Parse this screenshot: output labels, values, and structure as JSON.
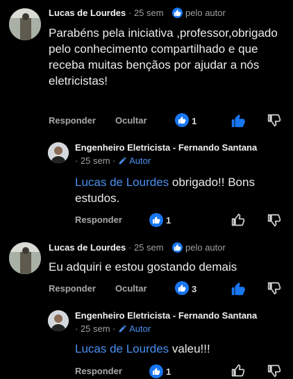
{
  "comments": [
    {
      "author": "Lucas de Lourdes",
      "time": "· 25 sem",
      "author_badge": "pelo autor",
      "text": "Parabéns pela iniciativa ,professor,obrigado pelo conhecimento compartilhado e que receba muitas bençãos por ajudar a nós eletricistas!",
      "reply_label": "Responder",
      "hide_label": "Ocultar",
      "like_count": "1",
      "liked": true,
      "reply": {
        "author": "Engenheiro Eletricista -  Fernando Santana",
        "time": "· 25 sem ·",
        "author_tag": "Autor",
        "mention": "Lucas de Lourdes",
        "text": " obrigado!! Bons estudos.",
        "reply_label": "Responder",
        "like_count": "1"
      }
    },
    {
      "author": "Lucas de Lourdes",
      "time": "· 25 sem",
      "author_badge": "pelo autor",
      "text": "Eu adquiri e  estou gostando demais",
      "reply_label": "Responder",
      "hide_label": "Ocultar",
      "like_count": "3",
      "liked": true,
      "reply": {
        "author": "Engenheiro Eletricista -  Fernando Santana",
        "time": "· 25 sem ·",
        "author_tag": "Autor",
        "mention": "Lucas de Lourdes",
        "text": " valeu!!!",
        "reply_label": "Responder",
        "like_count": "1"
      }
    }
  ],
  "colors": {
    "accent": "#1877f2",
    "mention": "#4a90f0",
    "background": "#000000"
  },
  "icons": [
    "thumbs-up-icon",
    "thumbs-down-icon",
    "pencil-icon"
  ]
}
